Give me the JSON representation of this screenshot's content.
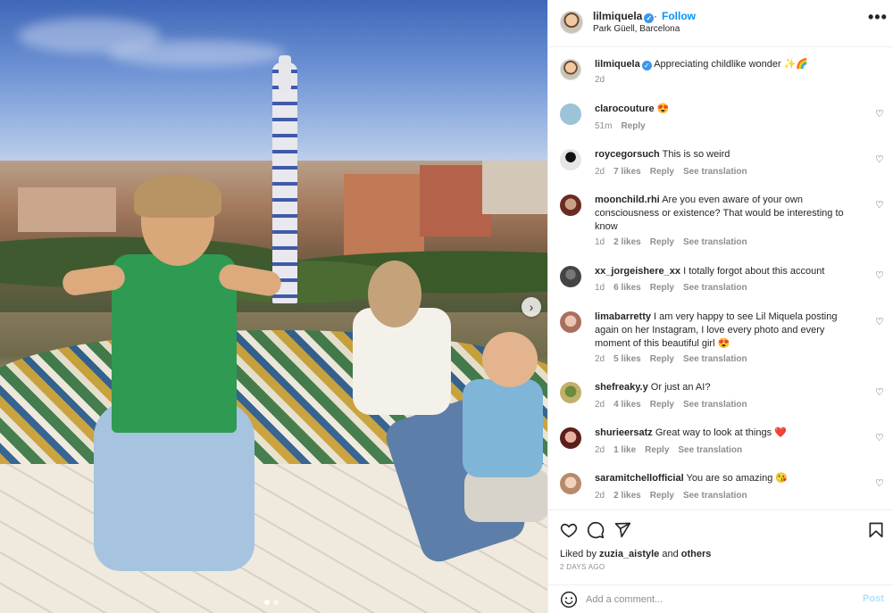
{
  "post": {
    "username": "lilmiquela",
    "follow_label": "Follow",
    "location": "Park Güell, Barcelona",
    "more_label": "•••",
    "verified_icon": "verified-badge-icon",
    "caption_text": "Appreciating childlike wonder ✨🌈",
    "caption_time": "2d"
  },
  "comments": [
    {
      "user": "clarocouture",
      "text": "😍",
      "time": "51m",
      "likes": "",
      "reply": "Reply",
      "translate": ""
    },
    {
      "user": "roycegorsuch",
      "text": "This is so weird",
      "time": "2d",
      "likes": "7 likes",
      "reply": "Reply",
      "translate": "See translation"
    },
    {
      "user": "moonchild.rhi",
      "text": "Are you even aware of your own consciousness or existence? That would be interesting to know",
      "time": "1d",
      "likes": "2 likes",
      "reply": "Reply",
      "translate": "See translation"
    },
    {
      "user": "xx_jorgeishere_xx",
      "text": "I totally forgot about this account",
      "time": "1d",
      "likes": "6 likes",
      "reply": "Reply",
      "translate": "See translation"
    },
    {
      "user": "limabarretty",
      "text": "I am very happy to see Lil Miquela posting again on her Instagram, I love every photo and every moment of this beautiful girl 😍",
      "time": "2d",
      "likes": "5 likes",
      "reply": "Reply",
      "translate": "See translation"
    },
    {
      "user": "shefreaky.y",
      "text": "Or just an AI?",
      "time": "2d",
      "likes": "4 likes",
      "reply": "Reply",
      "translate": "See translation"
    },
    {
      "user": "shurieersatz",
      "text": "Great way to look at things ❤️",
      "time": "2d",
      "likes": "1 like",
      "reply": "Reply",
      "translate": "See translation"
    },
    {
      "user": "saramitchellofficial",
      "text": "You are so amazing 😘",
      "time": "2d",
      "likes": "2 likes",
      "reply": "Reply",
      "translate": "See translation"
    }
  ],
  "footer": {
    "liked_by_prefix": "Liked by",
    "liked_by_user": "zuzia_aistyle",
    "liked_by_and": "and",
    "liked_by_others": "others",
    "time_ago": "2 DAYS AGO",
    "comment_placeholder": "Add a comment...",
    "post_label": "Post"
  },
  "carousel": {
    "current": 1,
    "total": 2
  },
  "colors": {
    "accent": "#0095f6",
    "text": "#262626",
    "muted": "#8e8e8e",
    "post_disabled": "#b2dffc"
  }
}
